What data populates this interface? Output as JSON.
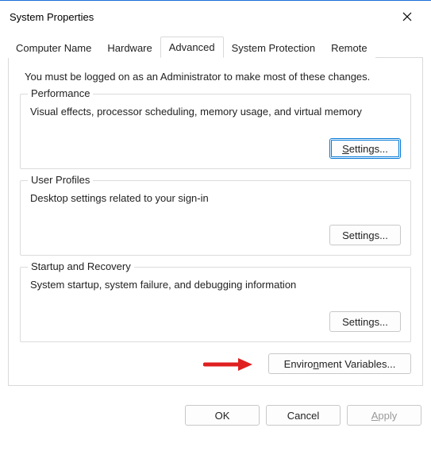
{
  "title": "System Properties",
  "tabs": {
    "computerName": "Computer Name",
    "hardware": "Hardware",
    "advanced": "Advanced",
    "systemProtection": "System Protection",
    "remote": "Remote"
  },
  "intro": "You must be logged on as an Administrator to make most of these changes.",
  "groups": {
    "performance": {
      "legend": "Performance",
      "desc": "Visual effects, processor scheduling, memory usage, and virtual memory",
      "buttonPrefix": "S",
      "buttonSuffix": "ettings..."
    },
    "userProfiles": {
      "legend": "User Profiles",
      "desc": "Desktop settings related to your sign-in",
      "buttonPrefix": "S",
      "buttonSuffix": "ettings..."
    },
    "startupRecovery": {
      "legend": "Startup and Recovery",
      "desc": "System startup, system failure, and debugging information",
      "buttonPrefix": "S",
      "buttonSuffix": "ettings..."
    }
  },
  "envBtn": {
    "prefix": "Enviro",
    "underline": "n",
    "suffix": "ment Variables..."
  },
  "footer": {
    "ok": "OK",
    "cancel": "Cancel",
    "applyUnderline": "A",
    "applySuffix": "pply"
  }
}
